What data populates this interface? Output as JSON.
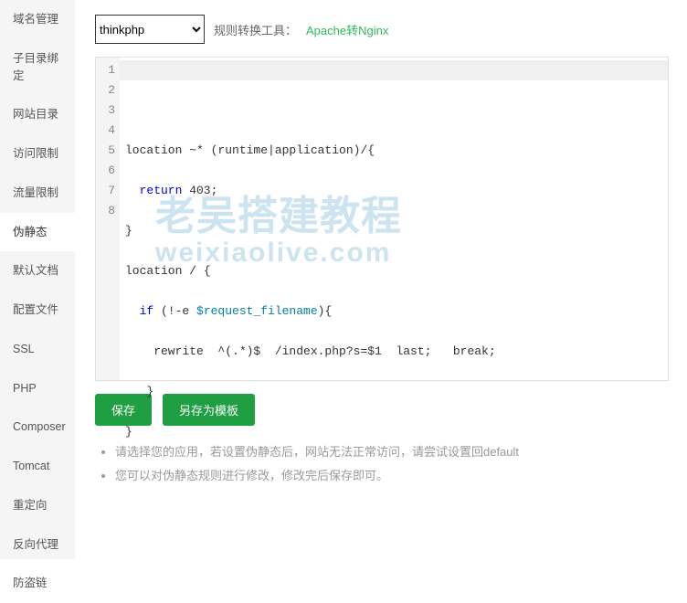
{
  "sidebar": {
    "items": [
      {
        "label": "域名管理"
      },
      {
        "label": "子目录绑定"
      },
      {
        "label": "网站目录"
      },
      {
        "label": "访问限制"
      },
      {
        "label": "流量限制"
      },
      {
        "label": "伪静态"
      },
      {
        "label": "默认文档"
      },
      {
        "label": "配置文件"
      },
      {
        "label": "SSL"
      },
      {
        "label": "PHP"
      },
      {
        "label": "Composer"
      },
      {
        "label": "Tomcat"
      },
      {
        "label": "重定向"
      },
      {
        "label": "反向代理"
      },
      {
        "label": "防盗链"
      }
    ],
    "active_index": 5
  },
  "topbar": {
    "select_value": "thinkphp",
    "tool_label": "规则转换工具：",
    "tool_link": "Apache转Nginx"
  },
  "editor": {
    "line_count": 8,
    "lines": {
      "l1": {
        "text": "location ~* (runtime|application)/{"
      },
      "l2": {
        "kw": "return",
        "rest": " 403;"
      },
      "l3": {
        "text": "}"
      },
      "l4": {
        "text": "location / {"
      },
      "l5": {
        "kw": "if",
        "rest": " (!-e ",
        "var": "$request_filename",
        "rest2": "){"
      },
      "l6": {
        "text": "rewrite  ^(.*)$  /index.php?s=$1  last;   break;"
      },
      "l7": {
        "text": " }"
      },
      "l8": {
        "text": "}"
      }
    }
  },
  "watermark": {
    "line1": "老吴搭建教程",
    "line2": "weixiaolive.com"
  },
  "actions": {
    "save": "保存",
    "save_as": "另存为模板"
  },
  "hints": [
    "请选择您的应用，若设置伪静态后，网站无法正常访问，请尝试设置回default",
    "您可以对伪静态规则进行修改，修改完后保存即可。"
  ]
}
